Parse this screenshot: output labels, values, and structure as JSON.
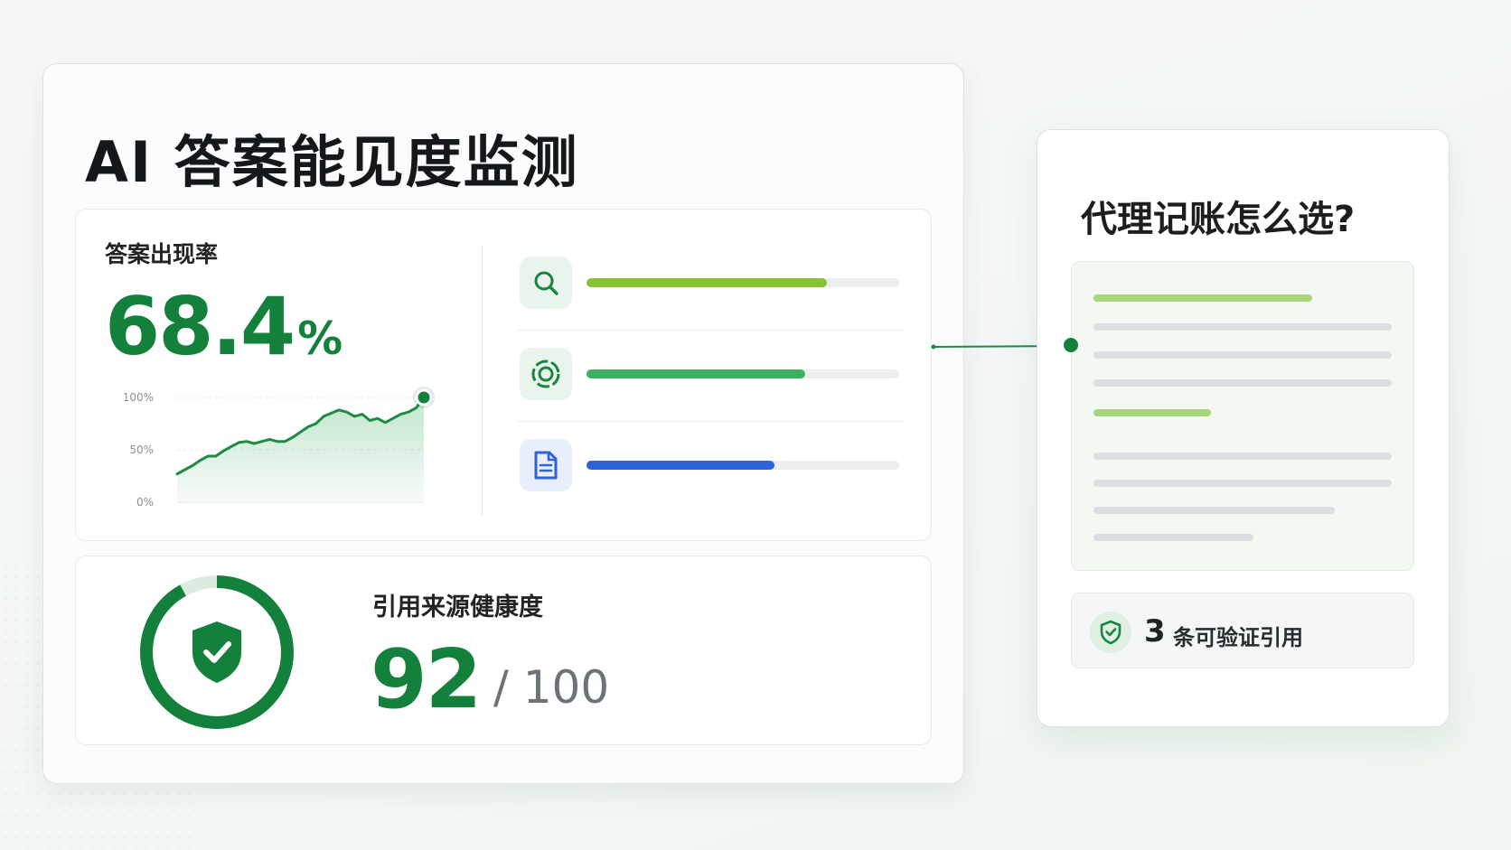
{
  "colors": {
    "brand_green": "#13803c",
    "accent_lime": "#86c232",
    "accent_green": "#3cb061",
    "accent_blue": "#2f62d6",
    "track_gray": "#ebedef"
  },
  "main": {
    "title": "AI 答案能见度监测",
    "appearance": {
      "label": "答案出现率",
      "value": "68.4",
      "unit": "%",
      "chart_data": {
        "type": "area",
        "x": [
          0,
          1,
          2,
          3,
          4,
          5,
          6,
          7,
          8,
          9,
          10,
          11,
          12,
          13,
          14,
          15,
          16,
          17,
          18,
          19,
          20,
          21,
          22,
          23,
          24,
          25,
          26,
          27,
          28,
          29,
          30,
          31,
          32
        ],
        "y": [
          27,
          31,
          35,
          40,
          44,
          44,
          49,
          53,
          57,
          58,
          56,
          58,
          60,
          58,
          58,
          62,
          67,
          72,
          75,
          82,
          85,
          88,
          86,
          82,
          84,
          78,
          80,
          76,
          80,
          84,
          86,
          90,
          100
        ],
        "ylim": [
          0,
          100
        ],
        "ytick_labels": [
          "100%",
          "50%",
          "0%"
        ],
        "grid": true,
        "xlabel": "",
        "ylabel": ""
      },
      "metrics": [
        {
          "icon": "search-icon",
          "progress": 0.77,
          "color": "#86c232"
        },
        {
          "icon": "target-icon",
          "progress": 0.7,
          "color": "#3cb061"
        },
        {
          "icon": "document-icon",
          "progress": 0.6,
          "color": "#2f62d6"
        }
      ]
    },
    "health": {
      "label": "引用来源健康度",
      "score": "92",
      "total": "/ 100",
      "ring_progress": 0.92,
      "icon": "shield-check-icon"
    }
  },
  "answer_card": {
    "question": "代理记账怎么选?",
    "citation": {
      "count": "3",
      "text": "条可验证引用",
      "icon": "shield-check-icon"
    }
  }
}
